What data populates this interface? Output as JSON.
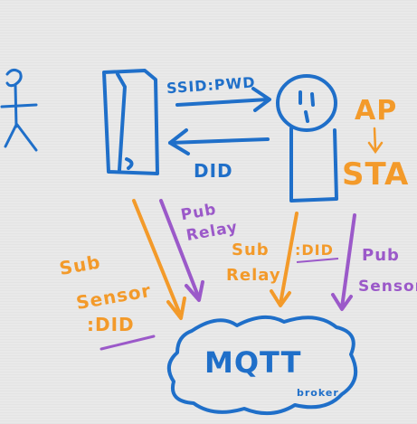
{
  "diagram": {
    "colors": {
      "blue": "#1f6fc9",
      "orange": "#f39a2a",
      "purple": "#9b59c9",
      "ink_dark": "#1f6fc9"
    },
    "arrow_top_label": "SSID:PWD",
    "arrow_bottom_label": "DID",
    "ap_label": "AP",
    "sta_label": "STA",
    "pub_relay_1": "Pub",
    "pub_relay_2": "Relay",
    "sub_relay_1": "Sub",
    "sub_relay_2": "Relay",
    "did_label_mid": ":DID",
    "pub_sensor_1": "Pub",
    "pub_sensor_2": "Sensor",
    "sub_sensor_1": "Sub",
    "sub_sensor_2": "Sensor",
    "sub_sensor_3": ":DID",
    "mqtt_label": "MQTT",
    "broker_label": "broker"
  }
}
